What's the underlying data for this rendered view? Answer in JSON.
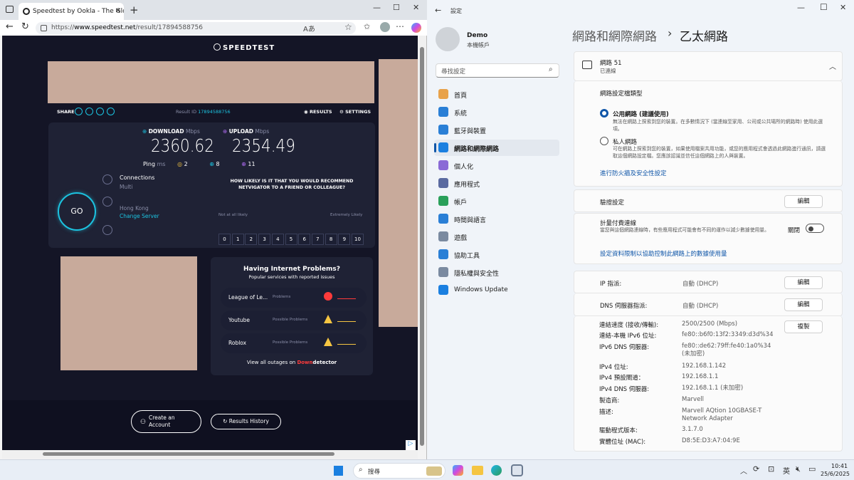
{
  "browser": {
    "tab_title": "Speedtest by Ookla - The Global",
    "url_prefix": "https://",
    "url_host": "www.speedtest.net",
    "url_path": "/result/17894588756"
  },
  "speedtest": {
    "logo": "SPEEDTEST",
    "share_label": "SHARE",
    "result_id_label": "Result ID",
    "result_id": "17894588756",
    "results_label": "RESULTS",
    "settings_label": "SETTINGS",
    "download_label": "DOWNLOAD",
    "upload_label": "UPLOAD",
    "unit": "Mbps",
    "download_value": "2360.62",
    "upload_value": "2354.49",
    "ping_label": "Ping",
    "ping_unit": "ms",
    "ping_idle": "2",
    "ping_down": "8",
    "ping_up": "11",
    "connections_label": "Connections",
    "connections_value": "Multi",
    "go_label": "GO",
    "server_location": "Hong Kong",
    "change_server": "Change Server",
    "nps_question": "HOW LIKELY IS IT THAT YOU WOULD RECOMMEND NETVIGATOR TO A FRIEND OR COLLEAGUE?",
    "nps_scale": [
      "0",
      "1",
      "2",
      "3",
      "4",
      "5",
      "6",
      "7",
      "8",
      "9",
      "10"
    ],
    "nps_low": "Not at all likely",
    "nps_high": "Extremely Likely",
    "problems_title": "Having Internet Problems?",
    "problems_subtitle": "Popular services with reported issues",
    "problems": [
      {
        "name": "League of Le...",
        "status": "Problems"
      },
      {
        "name": "Youtube",
        "status": "Possible Problems"
      },
      {
        "name": "Roblox",
        "status": "Possible Problems"
      }
    ],
    "outages_text": "View all outages on",
    "downdetector_a": "Down",
    "downdetector_b": "detector",
    "create_account": "Create an Account",
    "results_history": "Results History"
  },
  "settings": {
    "window_title": "設定",
    "user_name": "Demo",
    "user_type": "本機帳戶",
    "search_placeholder": "尋找設定",
    "breadcrumb_parent": "網路和網際網路",
    "breadcrumb_sep": "›",
    "breadcrumb_current": "乙太網路",
    "nav": [
      "首頁",
      "系統",
      "藍牙與裝置",
      "網路和網際網路",
      "個人化",
      "應用程式",
      "帳戶",
      "時間與語言",
      "遊戲",
      "協助工具",
      "隱私權與安全性",
      "Windows Update"
    ],
    "network_name": "網路 51",
    "network_status": "已連線",
    "profile_type_label": "網路設定檔類型",
    "public_title": "公用網路 (建議使用)",
    "public_desc": "無法在網路上探索到您的裝置。在多數情況下 (當連線至家用、公司或公共場所的網路時) 使用此選項。",
    "private_title": "私人網路",
    "private_desc": "可在網路上探索到您的裝置，如果使用檔案共用功能，或您的應用程式會透過此網路進行通訊，請選取這個網路設定檔。您應該認識並信任這個網路上的人與裝置。",
    "firewall_link": "進行防火牆及安全性設定",
    "auth_label": "驗證設定",
    "edit_label": "編輯",
    "metered_label": "計量付費連線",
    "metered_desc": "當您與這個網路連線時，有些應用程式可能會有不同的運作以減少數據使用量。",
    "toggle_label": "關閉",
    "data_limit_link": "設定資料限制以協助控制此網路上的數據使用量",
    "ip_assign_label": "IP 指派:",
    "ip_assign_value": "自動 (DHCP)",
    "dns_assign_label": "DNS 伺服器指派:",
    "dns_assign_value": "自動 (DHCP)",
    "copy_label": "複製",
    "props": [
      {
        "k": "連結速度 (接收/傳輸):",
        "v": "2500/2500 (Mbps)"
      },
      {
        "k": "連結-本機 IPv6 位址:",
        "v": "fe80::b6f0:13f2:3349:d3d%34"
      },
      {
        "k": "IPv6 DNS 伺服器:",
        "v": "fe80::de62:79ff:fe40:1a0%34 (未加密)"
      },
      {
        "k": "IPv4 位址:",
        "v": "192.168.1.142"
      },
      {
        "k": "IPv4 預設閘道：",
        "v": "192.168.1.1"
      },
      {
        "k": "IPv4 DNS 伺服器:",
        "v": "192.168.1.1 (未加密)"
      },
      {
        "k": "製造商:",
        "v": "Marvell"
      },
      {
        "k": "描述:",
        "v": "Marvell AQtion 10GBASE-T Network Adapter"
      },
      {
        "k": "驅動程式版本:",
        "v": "3.1.7.0"
      },
      {
        "k": "實體位址 (MAC):",
        "v": "D8:5E:D3:A7:04:9E"
      }
    ]
  },
  "taskbar": {
    "search_placeholder": "搜尋",
    "ime": "英",
    "time": "10:41",
    "date": "25/6/2025"
  }
}
